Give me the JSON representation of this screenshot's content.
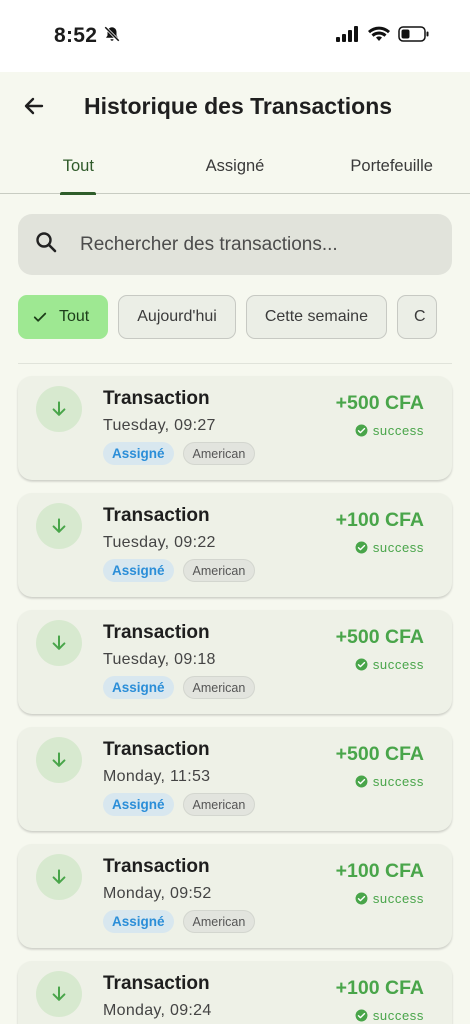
{
  "status_bar": {
    "time": "8:52"
  },
  "header": {
    "title": "Historique des Transactions"
  },
  "tabs": [
    {
      "label": "Tout",
      "active": true
    },
    {
      "label": "Assigné",
      "active": false
    },
    {
      "label": "Portefeuille",
      "active": false
    }
  ],
  "search": {
    "placeholder": "Rechercher des transactions..."
  },
  "filters": [
    {
      "label": "Tout",
      "active": true
    },
    {
      "label": "Aujourd'hui",
      "active": false
    },
    {
      "label": "Cette semaine",
      "active": false
    },
    {
      "label": "C",
      "active": false
    }
  ],
  "transactions": [
    {
      "title": "Transaction",
      "date": "Tuesday, 09:27",
      "badge_assign": "Assigné",
      "badge_type": "American",
      "amount": "+500 CFA",
      "status": "success"
    },
    {
      "title": "Transaction",
      "date": "Tuesday, 09:22",
      "badge_assign": "Assigné",
      "badge_type": "American",
      "amount": "+100 CFA",
      "status": "success"
    },
    {
      "title": "Transaction",
      "date": "Tuesday, 09:18",
      "badge_assign": "Assigné",
      "badge_type": "American",
      "amount": "+500 CFA",
      "status": "success"
    },
    {
      "title": "Transaction",
      "date": "Monday, 11:53",
      "badge_assign": "Assigné",
      "badge_type": "American",
      "amount": "+500 CFA",
      "status": "success"
    },
    {
      "title": "Transaction",
      "date": "Monday, 09:52",
      "badge_assign": "Assigné",
      "badge_type": "American",
      "amount": "+100 CFA",
      "status": "success"
    },
    {
      "title": "Transaction",
      "date": "Monday, 09:24",
      "badge_assign": "",
      "badge_type": "",
      "amount": "+100 CFA",
      "status": "success"
    }
  ],
  "colors": {
    "accent": "#2e5d2a",
    "success": "#49a54a",
    "chip_active": "#9ee892"
  }
}
